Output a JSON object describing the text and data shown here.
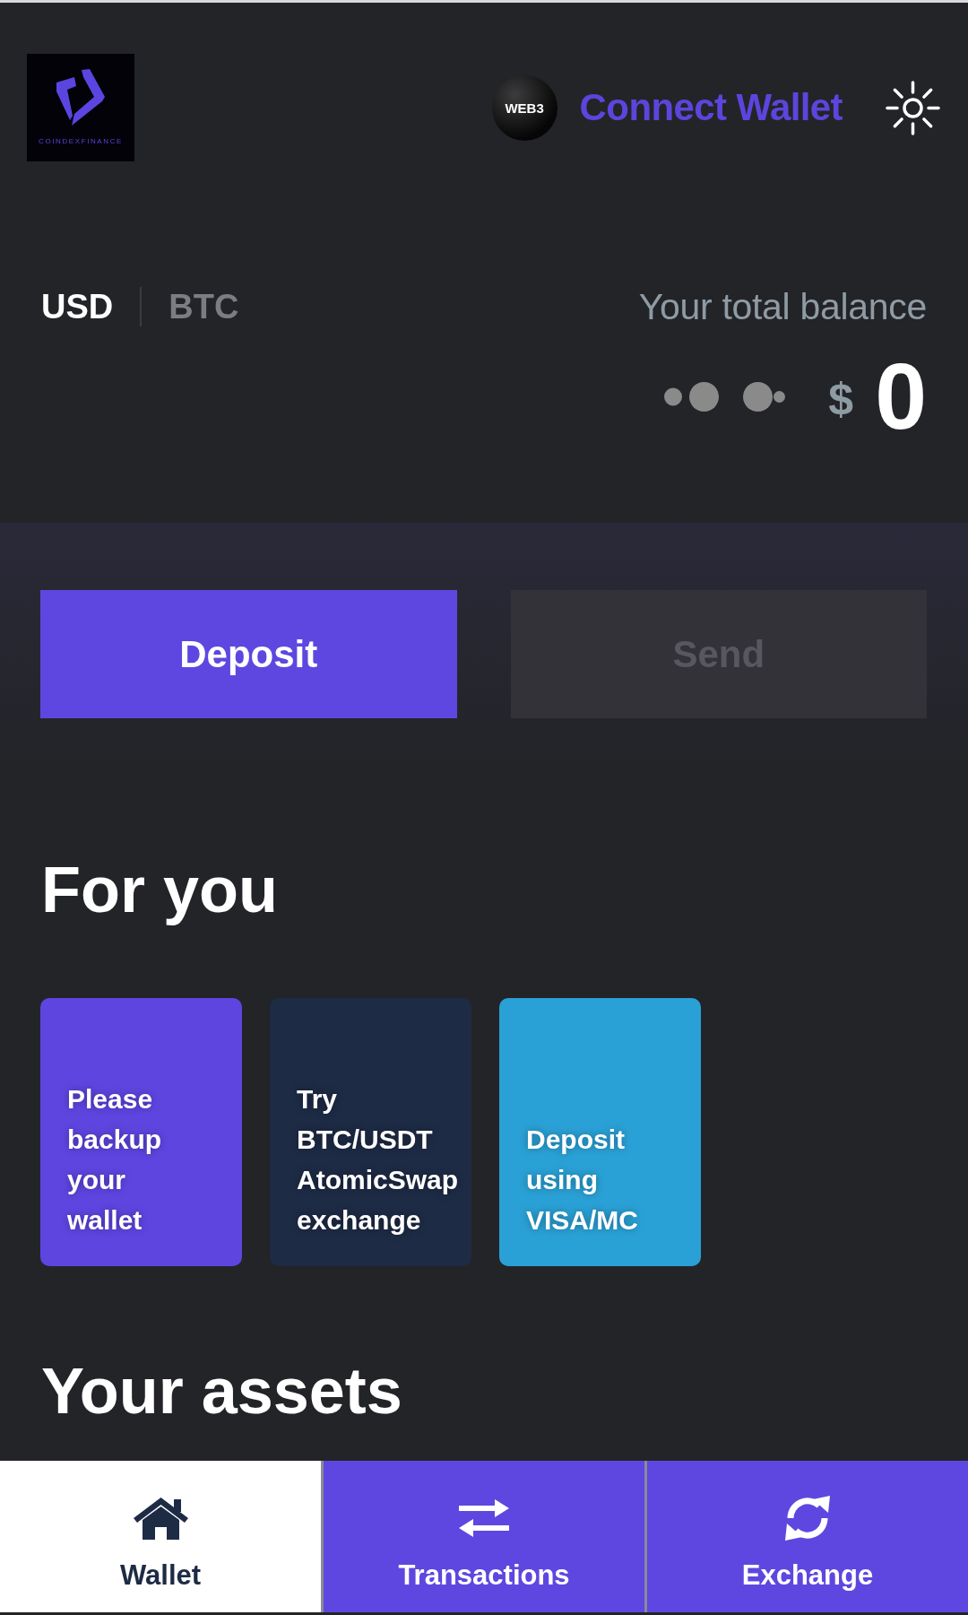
{
  "header": {
    "logo_text": "COINDEXFINANCE",
    "web3_badge": "WEB3",
    "connect_wallet": "Connect Wallet"
  },
  "balance": {
    "currencies": [
      {
        "label": "USD",
        "selected": true
      },
      {
        "label": "BTC",
        "selected": false
      }
    ],
    "label": "Your total balance",
    "currency_symbol": "$",
    "amount": "0"
  },
  "actions": [
    {
      "label": "Deposit",
      "disabled": false
    },
    {
      "label": "Send",
      "disabled": true
    }
  ],
  "for_you": {
    "title": "For you",
    "cards": [
      {
        "text": "Please backup your wallet",
        "color": "#5e45e0"
      },
      {
        "text": "Try BTC/USDT AtomicSwap exchange",
        "color": "#1e2b45"
      },
      {
        "text": "Deposit using VISA/MC",
        "color": "#2aa1d6"
      }
    ]
  },
  "assets": {
    "title": "Your assets"
  },
  "tabs": [
    {
      "label": "Wallet",
      "selected": true
    },
    {
      "label": "Transactions",
      "selected": false
    },
    {
      "label": "Exchange",
      "selected": false
    }
  ]
}
